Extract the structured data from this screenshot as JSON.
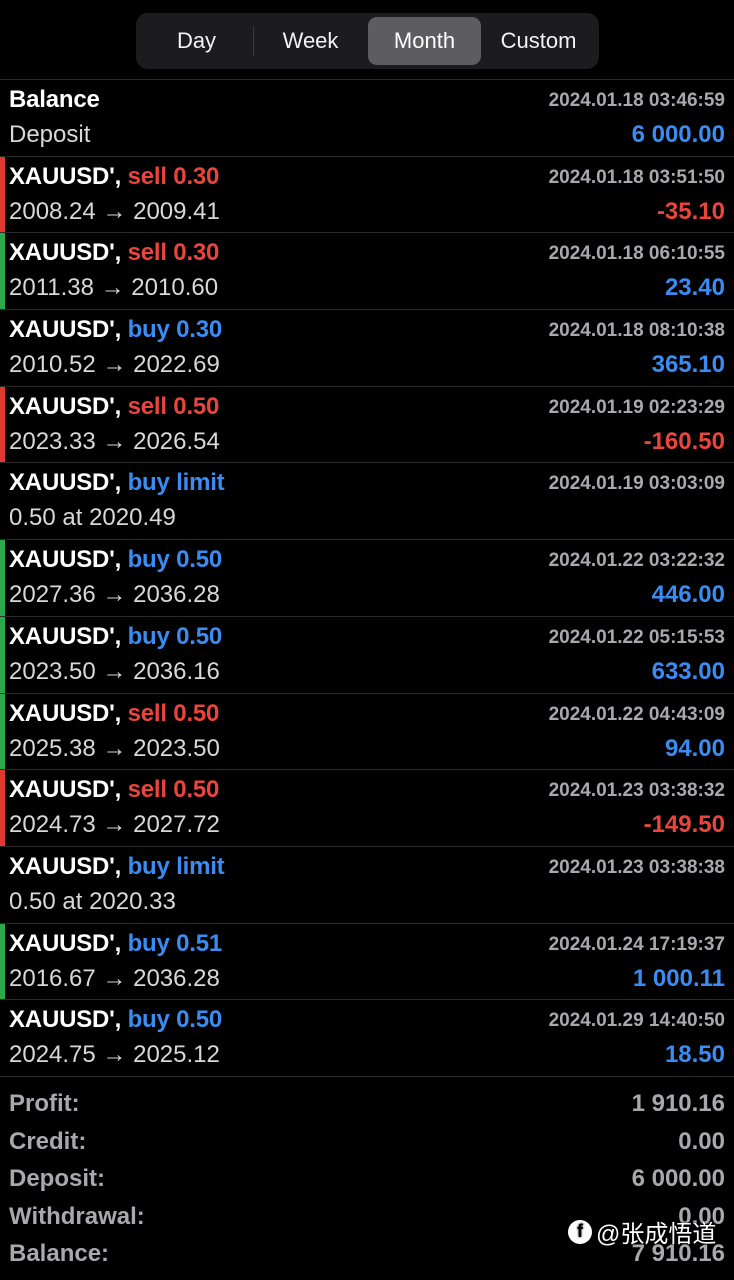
{
  "period_tabs": {
    "items": [
      "Day",
      "Week",
      "Month",
      "Custom"
    ],
    "active": "Month"
  },
  "balance_row": {
    "title": "Balance",
    "subtitle": "Deposit",
    "time": "2024.01.18 03:46:59",
    "amount": "6 000.00"
  },
  "trades": [
    {
      "symbol": "XAUUSD'",
      "sep": ", ",
      "action": "sell 0.30",
      "side": "sell",
      "bar": "red",
      "prices": "2008.24 → 2009.41",
      "time": "2024.01.18 03:51:50",
      "amount": "-35.10",
      "sign": "neg"
    },
    {
      "symbol": "XAUUSD'",
      "sep": ", ",
      "action": "sell 0.30",
      "side": "sell",
      "bar": "green",
      "prices": "2011.38 → 2010.60",
      "time": "2024.01.18 06:10:55",
      "amount": "23.40",
      "sign": "pos"
    },
    {
      "symbol": "XAUUSD'",
      "sep": ", ",
      "action": "buy 0.30",
      "side": "buy",
      "bar": "none",
      "prices": "2010.52 → 2022.69",
      "time": "2024.01.18 08:10:38",
      "amount": "365.10",
      "sign": "pos"
    },
    {
      "symbol": "XAUUSD'",
      "sep": ", ",
      "action": "sell 0.50",
      "side": "sell",
      "bar": "red",
      "prices": "2023.33 → 2026.54",
      "time": "2024.01.19 02:23:29",
      "amount": "-160.50",
      "sign": "neg"
    },
    {
      "symbol": "XAUUSD'",
      "sep": ", ",
      "action": "buy limit",
      "side": "buy",
      "bar": "none",
      "prices": "0.50 at 2020.49",
      "time": "2024.01.19 03:03:09",
      "amount": "",
      "sign": "pos"
    },
    {
      "symbol": "XAUUSD'",
      "sep": ", ",
      "action": "buy 0.50",
      "side": "buy",
      "bar": "green",
      "prices": "2027.36 → 2036.28",
      "time": "2024.01.22 03:22:32",
      "amount": "446.00",
      "sign": "pos"
    },
    {
      "symbol": "XAUUSD'",
      "sep": ", ",
      "action": "buy 0.50",
      "side": "buy",
      "bar": "green",
      "prices": "2023.50 → 2036.16",
      "time": "2024.01.22 05:15:53",
      "amount": "633.00",
      "sign": "pos"
    },
    {
      "symbol": "XAUUSD'",
      "sep": ", ",
      "action": "sell 0.50",
      "side": "sell",
      "bar": "green",
      "prices": "2025.38 → 2023.50",
      "time": "2024.01.22 04:43:09",
      "amount": "94.00",
      "sign": "pos"
    },
    {
      "symbol": "XAUUSD'",
      "sep": ", ",
      "action": "sell 0.50",
      "side": "sell",
      "bar": "red",
      "prices": "2024.73 → 2027.72",
      "time": "2024.01.23 03:38:32",
      "amount": "-149.50",
      "sign": "neg"
    },
    {
      "symbol": "XAUUSD'",
      "sep": ", ",
      "action": "buy limit",
      "side": "buy",
      "bar": "none",
      "prices": "0.50 at 2020.33",
      "time": "2024.01.23 03:38:38",
      "amount": "",
      "sign": "pos"
    },
    {
      "symbol": "XAUUSD'",
      "sep": ", ",
      "action": "buy 0.51",
      "side": "buy",
      "bar": "green",
      "prices": "2016.67 → 2036.28",
      "time": "2024.01.24 17:19:37",
      "amount": "1 000.11",
      "sign": "pos"
    },
    {
      "symbol": "XAUUSD'",
      "sep": ", ",
      "action": "buy 0.50",
      "side": "buy",
      "bar": "none",
      "prices": "2024.75 → 2025.12",
      "time": "2024.01.29 14:40:50",
      "amount": "18.50",
      "sign": "pos"
    }
  ],
  "summary": [
    {
      "label": "Profit:",
      "value": "1 910.16"
    },
    {
      "label": "Credit:",
      "value": "0.00"
    },
    {
      "label": "Deposit:",
      "value": "6 000.00"
    },
    {
      "label": "Withdrawal:",
      "value": "0.00"
    },
    {
      "label": "Balance:",
      "value": "7 910.16"
    }
  ],
  "watermark": {
    "icon": "facebook-icon",
    "text": "@张成悟道"
  },
  "colors": {
    "loss": "#e8453c",
    "profit": "#3b8cf2",
    "bar_red": "#e0392f",
    "bar_green": "#2aa84a"
  }
}
